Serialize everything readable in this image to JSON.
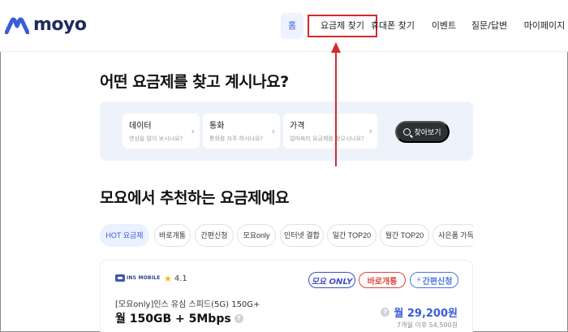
{
  "brand": {
    "name": "moyo",
    "color": "#3b5bdb"
  },
  "nav": {
    "items": [
      {
        "label": "홈",
        "active": true
      },
      {
        "label": "요금제 찾기",
        "highlighted": true
      },
      {
        "label": "휴대폰 찾기"
      },
      {
        "label": "이벤트"
      },
      {
        "label": "질문/답변"
      },
      {
        "label": "마이페이지"
      }
    ]
  },
  "search": {
    "headline": "어떤 요금제를 찾고 계시나요?",
    "filters": [
      {
        "title": "데이터",
        "subtitle": "영상을 많이 보시나요?",
        "icon": "chevron-right-icon"
      },
      {
        "title": "통화",
        "subtitle": "통화를 자주 하시나요?",
        "icon": "chevron-right-icon"
      },
      {
        "title": "가격",
        "subtitle": "얼마짜리 요금제를 찾으시나요?",
        "icon": "chevron-right-icon"
      }
    ],
    "find_button": "찾아보기",
    "find_icon": "search-icon"
  },
  "annotation": {
    "color": "#d42a2a"
  },
  "recommend": {
    "title": "모요에서 추천하는 요금제예요",
    "chips": [
      {
        "label": "HOT 요금제",
        "active": true
      },
      {
        "label": "바로개통"
      },
      {
        "label": "간편신청"
      },
      {
        "label": "모요only"
      },
      {
        "label": "인터넷 결합"
      },
      {
        "label": "일간 TOP20"
      },
      {
        "label": "월간 TOP20"
      },
      {
        "label": "사은품 가득"
      }
    ]
  },
  "plan": {
    "carrier": "INS MOBILE",
    "rating": "4.1",
    "badges": [
      "모요 ONLY",
      "바로개통",
      "간편신청"
    ],
    "name": "[모요only]인스 유심 스피드(5G) 150G+",
    "data": "월 150GB + 5Mbps",
    "price": "월 29,200원",
    "price_after": "7개월 이후 54,500원"
  }
}
